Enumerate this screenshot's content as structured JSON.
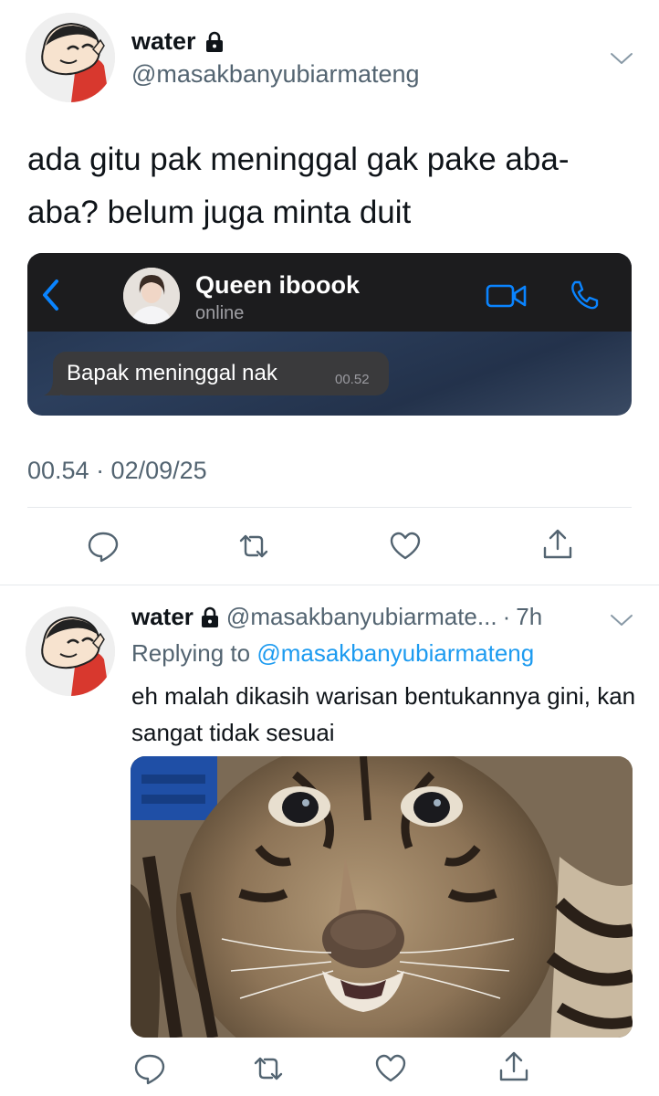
{
  "main_tweet": {
    "name": "water",
    "handle": "@masakbanyubiarmateng",
    "text": "ada gitu pak meninggal gak pake aba-aba? belum juga minta duit",
    "timestamp": "00.54 · 02/09/25",
    "icons": [
      "lock-icon",
      "chevron-down-icon",
      "reply-icon",
      "retweet-icon",
      "like-icon",
      "share-icon"
    ]
  },
  "chat_image": {
    "contact_name": "Queen iboook",
    "status": "online",
    "message": "Bapak meninggal nak",
    "message_time": "00.52",
    "icons": [
      "back-chevron-icon",
      "video-call-icon",
      "phone-icon"
    ],
    "accent_color": "#0a84ff"
  },
  "reply_tweet": {
    "name": "water",
    "handle": "@masakbanyubiarmate...",
    "separator": "·",
    "time": "7h",
    "replying_prefix": "Replying to",
    "replying_handle": "@masakbanyubiarmateng",
    "text": "eh malah dikasih warisan bentukannya gini, kan sangat tidak sesuai"
  },
  "colors": {
    "text": "#0f1419",
    "secondary": "#536471",
    "link": "#1d9bf0",
    "divider": "#e6e9ec"
  }
}
